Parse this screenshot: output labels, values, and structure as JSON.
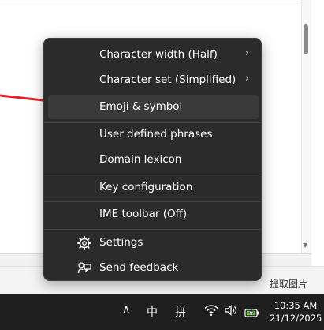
{
  "menu": {
    "items": [
      {
        "label": "Character width (Half)",
        "submenu": true
      },
      {
        "label": "Character set (Simplified)",
        "submenu": true
      },
      {
        "label": "Emoji & symbol",
        "highlighted": true
      },
      {
        "label": "User defined phrases"
      },
      {
        "label": "Domain lexicon"
      },
      {
        "label": "Key configuration"
      },
      {
        "label": "IME toolbar (Off)"
      },
      {
        "label": "Settings",
        "icon": "gear-icon"
      },
      {
        "label": "Send feedback",
        "icon": "feedback-icon"
      }
    ],
    "submenu_glyph": "›"
  },
  "background": {
    "extract_label": "提取图片"
  },
  "taskbar": {
    "overflow_glyph": "∧",
    "ime_mode": "中",
    "ime_input": "拼",
    "time": "10:35 AM",
    "date": "21/12/2025"
  },
  "colors": {
    "menu_bg": "#2b2b2b",
    "menu_hover": "#3a3a3a",
    "taskbar_bg": "#1f1f1f",
    "arrow": "#e0242a",
    "battery": "#6cc04a"
  }
}
